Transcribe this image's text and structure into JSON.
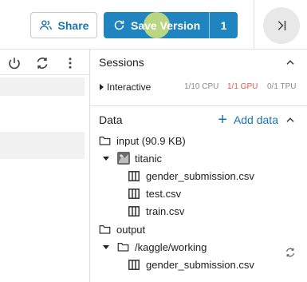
{
  "topbar": {
    "share_label": "Share",
    "save_label": "Save Version",
    "save_count": "1"
  },
  "sessions": {
    "title": "Sessions",
    "row_label": "Interactive",
    "cpu": "1/10 CPU",
    "gpu": "1/1 GPU",
    "tpu": "0/1 TPU"
  },
  "data": {
    "title": "Data",
    "add_label": "Add data",
    "input_label": "input (90.9 KB)",
    "dataset_name": "titanic",
    "input_files": [
      "gender_submission.csv",
      "test.csv",
      "train.csv"
    ],
    "output_label": "output",
    "working_dir": "/kaggle/working",
    "output_files": [
      "gender_submission.csv"
    ]
  },
  "colors": {
    "accent": "#1f84c0",
    "link": "#1a73b4",
    "gpu_stat": "#e05a4f"
  },
  "icons": [
    "share-users-icon",
    "save-refresh-icon",
    "collapse-panel-icon",
    "power-icon",
    "sync-icon",
    "more-vertical-icon",
    "chevron-up-icon",
    "plus-icon",
    "folder-icon",
    "dataset-thumbnail-icon",
    "table-icon",
    "refresh-icon"
  ]
}
